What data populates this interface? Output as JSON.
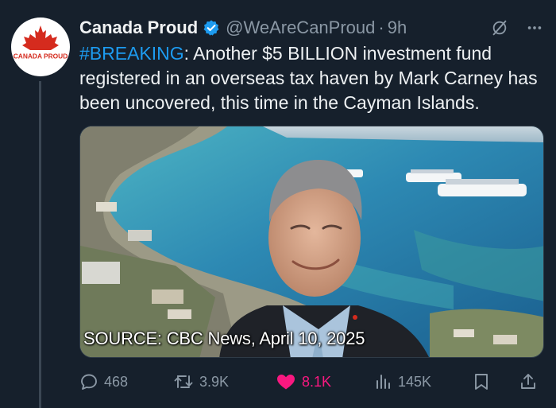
{
  "tweet": {
    "display_name": "Canada Proud",
    "handle": "@WeAreCanProud",
    "separator": "·",
    "time": "9h",
    "hashtag": "#BREAKING",
    "text_after_hashtag": ": Another $5 BILLION investment fund registered in an overseas tax haven by Mark Carney has been uncovered, this time in the Cayman Islands.",
    "avatar": {
      "label": "CANADA PROUD",
      "icon": "maple-leaf-icon",
      "accent": "#d52b1e"
    },
    "verified_color": "#1d9bf0",
    "header_icons": [
      "grok-slash-icon",
      "more-icon"
    ]
  },
  "media": {
    "caption": "SOURCE: CBC News, April 10, 2025"
  },
  "actions": {
    "replies": "468",
    "reposts": "3.9K",
    "likes": "8.1K",
    "views": "145K",
    "like_color": "#f91880",
    "icons": [
      "reply-icon",
      "repost-icon",
      "heart-icon",
      "views-icon",
      "bookmark-icon",
      "share-icon"
    ]
  }
}
